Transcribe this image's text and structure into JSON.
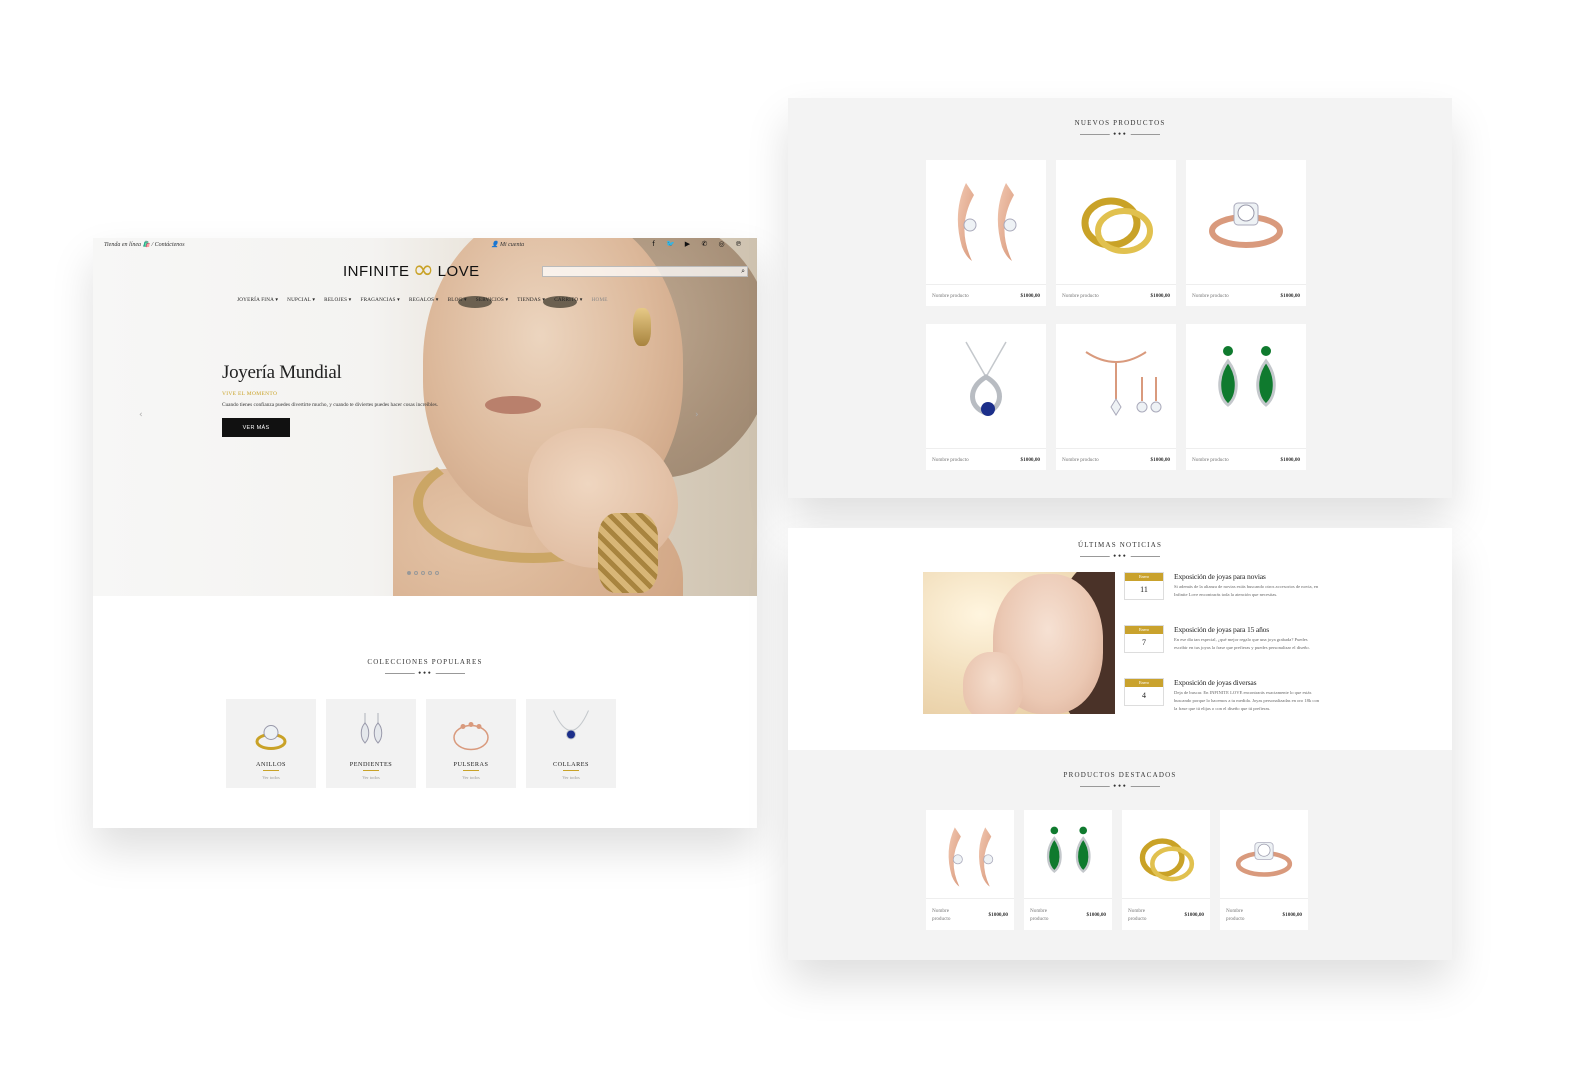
{
  "home": {
    "topbar": {
      "left_text": "Tienda en línea 🛍️ / Contáctenos",
      "account": "👤 Mi cuenta"
    },
    "socials": [
      {
        "icon": "facebook-icon",
        "glyph": "f"
      },
      {
        "icon": "twitter-icon",
        "glyph": "🐦"
      },
      {
        "icon": "youtube-icon",
        "glyph": "▶"
      },
      {
        "icon": "whatsapp-icon",
        "glyph": "✆"
      },
      {
        "icon": "instagram-icon",
        "glyph": "◎"
      },
      {
        "icon": "pinterest-icon",
        "glyph": "℗"
      }
    ],
    "logo": {
      "left": "INFINITE",
      "symbol": "∞",
      "right": "LOVE"
    },
    "search": {
      "placeholder": "",
      "icon_glyph": "⌕"
    },
    "nav": [
      "JOYERÍA FINA ▾",
      "NUPCIAL ▾",
      "RELOJES ▾",
      "FRAGANCIAS ▾",
      "REGALOS ▾",
      "BLOG ▾",
      "SERVICIOS ▾",
      "TIENDAS ▾",
      "CARRITO ▾",
      "HOME"
    ],
    "hero": {
      "title": "Joyería Mundial",
      "subtitle": "VIVE EL MOMENTO",
      "description": "Cuando tienes confianza puedes divertirte mucho, y cuando te diviertes puedes hacer cosas increíbles.",
      "button": "VER MÁS",
      "prev_glyph": "‹",
      "next_glyph": "›",
      "slides": 5,
      "active_slide": 1
    },
    "collections": {
      "title": "COLECCIONES POPULARES",
      "ornament": "•••",
      "items": [
        {
          "name": "ANILLOS",
          "link": "Ver todos"
        },
        {
          "name": "PENDIENTES",
          "link": "Ver todos"
        },
        {
          "name": "PULSERAS",
          "link": "Ver todos"
        },
        {
          "name": "COLLARES",
          "link": "Ver todos"
        }
      ]
    }
  },
  "new_products": {
    "title": "NUEVOS PRODUCTOS",
    "ornament": "•••",
    "items": [
      {
        "name": "Nombre producto",
        "price": "$1000,00",
        "type": "rose-earrings"
      },
      {
        "name": "Nombre producto",
        "price": "$1000,00",
        "type": "gold-rings"
      },
      {
        "name": "Nombre producto",
        "price": "$1000,00",
        "type": "rose-ring"
      },
      {
        "name": "Nombre producto",
        "price": "$1000,00",
        "type": "sapphire-pendant"
      },
      {
        "name": "Nombre producto",
        "price": "$1000,00",
        "type": "rose-set"
      },
      {
        "name": "Nombre producto",
        "price": "$1000,00",
        "type": "emerald-earrings"
      }
    ]
  },
  "news": {
    "title": "ÚLTIMAS NOTICIAS",
    "ornament": "•••",
    "items": [
      {
        "month": "Enero",
        "day": "11",
        "title": "Exposición de joyas para novias",
        "text": "Si además de la alianza de novias estás buscando otros accesorios de novia, en Infinite Love encontrarás toda la atención que necesitas."
      },
      {
        "month": "Enero",
        "day": "7",
        "title": "Exposición de joyas para 15 años",
        "text": "En ese día tan especial, ¿qué mejor regalo que una joya grabada? Puedes escribir en tus joyas la frase que prefieras y puedes personalizar el diseño."
      },
      {
        "month": "Enero",
        "day": "4",
        "title": "Exposición de joyas diversas",
        "text": "Deja de buscar. En INFINITE LOVE encontrarás exactamente lo que estás buscando porque lo hacemos a tu medida. Joyas personalizadas en oro 18k con la frase que tú elijas o con el diseño que tú prefieras."
      }
    ]
  },
  "featured": {
    "title": "PRODUCTOS DESTACADOS",
    "ornament": "•••",
    "items": [
      {
        "name": "Nombre producto",
        "price": "$1000,00",
        "type": "rose-earrings"
      },
      {
        "name": "Nombre producto",
        "price": "$1000,00",
        "type": "emerald-earrings"
      },
      {
        "name": "Nombre producto",
        "price": "$1000,00",
        "type": "gold-rings"
      },
      {
        "name": "Nombre producto",
        "price": "$1000,00",
        "type": "rose-ring"
      }
    ]
  },
  "colors": {
    "gold": "#c9a227",
    "rose": "#d99a7d",
    "silver": "#c4c8cc",
    "sapphire": "#1c2f8a",
    "emerald": "#0f7a2e",
    "dark": "#111111",
    "panel_gray": "#f3f3f3"
  }
}
